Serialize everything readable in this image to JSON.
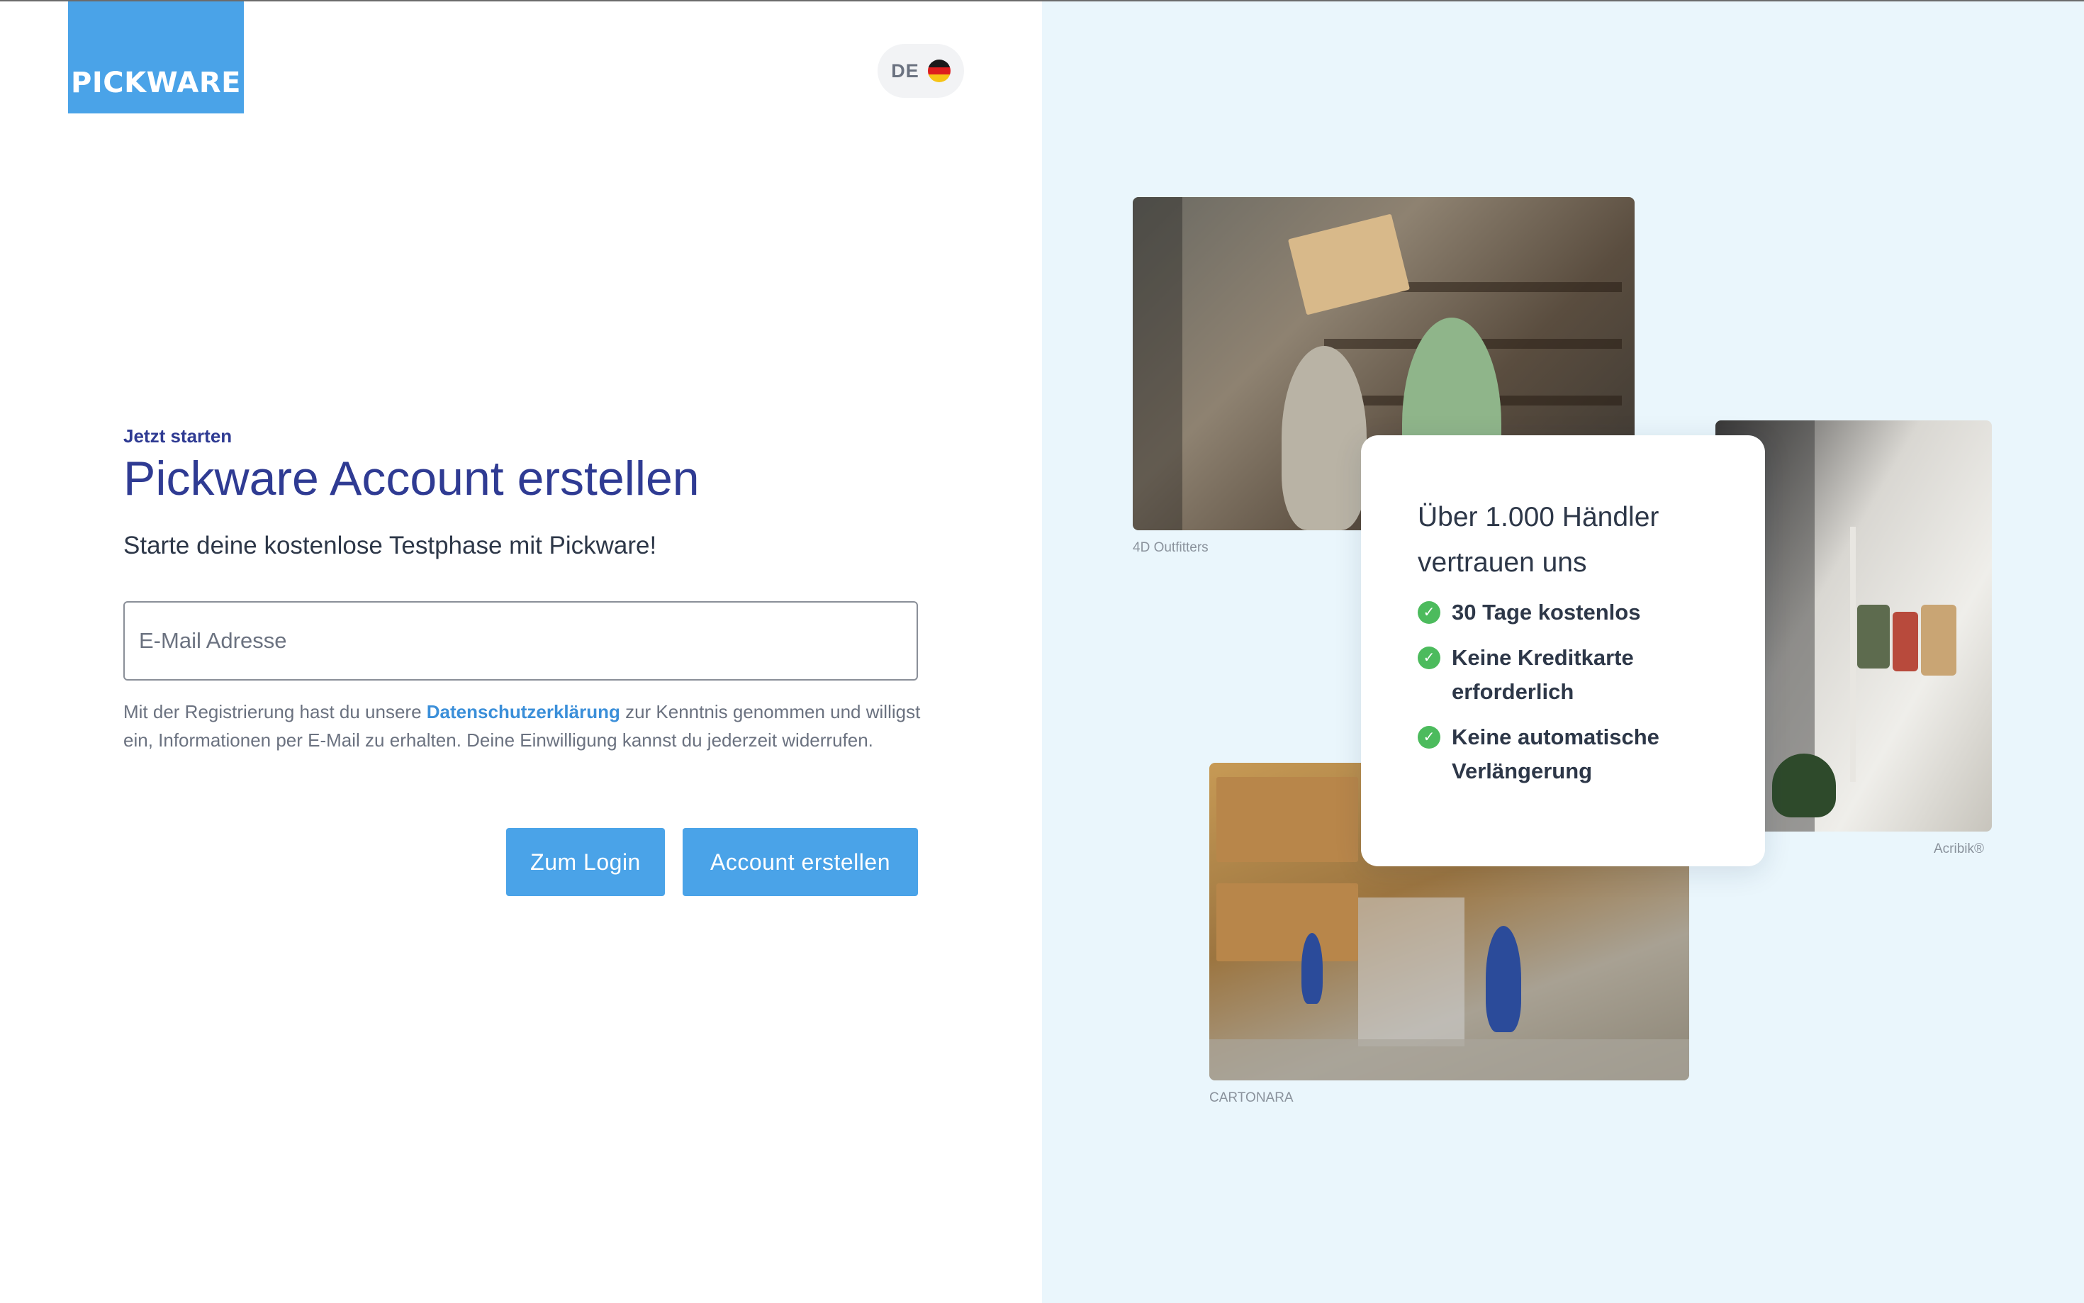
{
  "brand": {
    "logo_text": "PICKWARE",
    "accent": "#4aa3e8",
    "title_color": "#2f3b93"
  },
  "language": {
    "code": "DE",
    "flag": "germany-flag-icon"
  },
  "form": {
    "eyebrow": "Jetzt starten",
    "title": "Pickware Account erstellen",
    "subtitle": "Starte deine kostenlose Testphase mit Pickware!",
    "email_placeholder": "E-Mail Adresse",
    "email_value": "",
    "consent_before": "Mit der Registrierung hast du unsere ",
    "consent_link": "Datenschutzerklärung",
    "consent_after": " zur Kenntnis genommen und willigst ein, Informationen per E-Mail zu erhalten. Deine Einwilligung kannst du jederzeit widerrufen.",
    "login_button": "Zum Login",
    "create_button": "Account erstellen"
  },
  "showcase": {
    "card_title": "Über 1.000 Händler vertrauen uns",
    "benefits": [
      "30 Tage kostenlos",
      "Keine Kreditkarte erforderlich",
      "Keine automatische Verlängerung"
    ],
    "captions": [
      "4D Outfitters",
      "Acribik®",
      "CARTONARA"
    ]
  }
}
